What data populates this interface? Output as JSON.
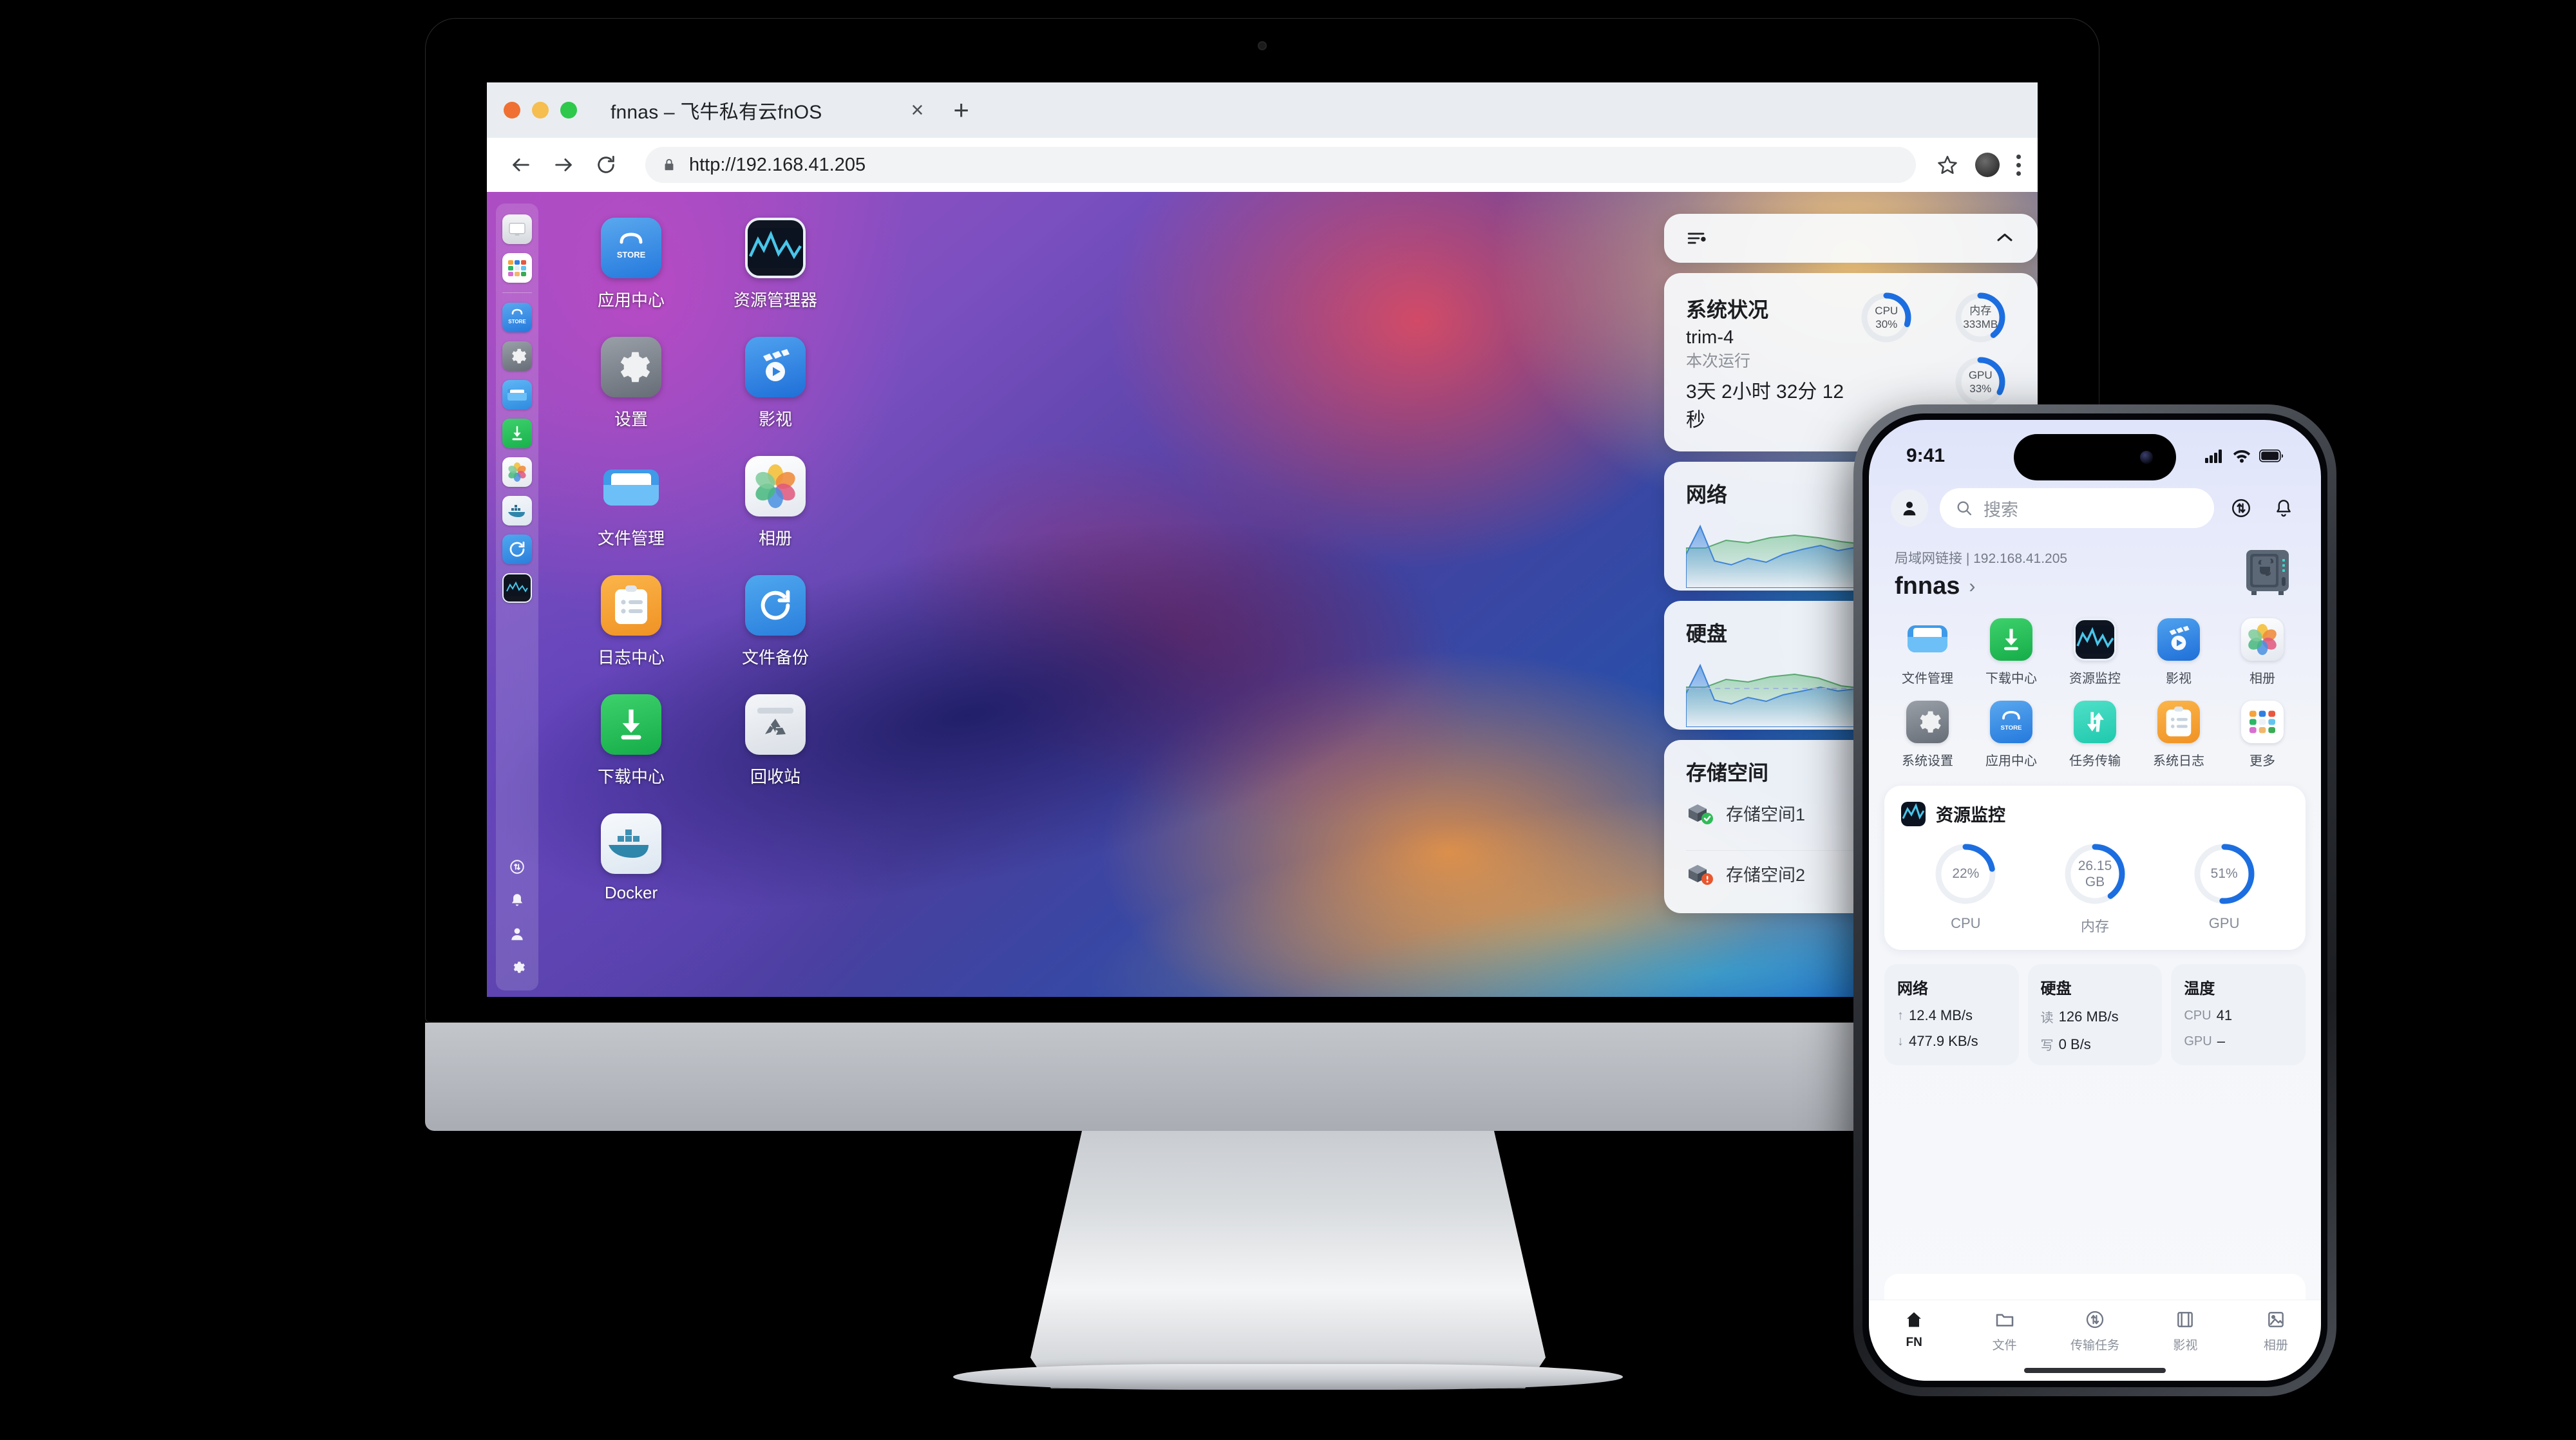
{
  "browser": {
    "tab_title": "fnnas – 飞牛私有云fnOS",
    "close_label": "×",
    "newtab_label": "+",
    "url": "http://192.168.41.205",
    "back_icon": "back-arrow-icon",
    "forward_icon": "forward-arrow-icon",
    "reload_icon": "reload-icon",
    "lock_icon": "lock-icon",
    "bookmark_icon": "star-icon",
    "profile_icon": "profile-avatar-icon",
    "menu_icon": "kebab-menu-icon"
  },
  "desktop": {
    "icons": [
      {
        "label": "应用中心",
        "icon": "app-store-icon"
      },
      {
        "label": "资源管理器",
        "icon": "resource-monitor-icon"
      },
      {
        "label": "设置",
        "icon": "settings-gear-icon"
      },
      {
        "label": "影视",
        "icon": "media-video-icon"
      },
      {
        "label": "文件管理",
        "icon": "file-manager-folder-icon"
      },
      {
        "label": "相册",
        "icon": "photos-flower-icon"
      },
      {
        "label": "日志中心",
        "icon": "log-center-clipboard-icon"
      },
      {
        "label": "文件备份",
        "icon": "file-backup-sync-icon"
      },
      {
        "label": "下载中心",
        "icon": "download-center-icon"
      },
      {
        "label": "回收站",
        "icon": "recycle-bin-icon"
      },
      {
        "label": "Docker",
        "icon": "docker-whale-icon"
      }
    ],
    "dock": [
      {
        "icon": "display-monitor-icon"
      },
      {
        "icon": "app-launcher-grid-icon"
      },
      {
        "icon": "app-store-icon"
      },
      {
        "icon": "settings-gear-icon"
      },
      {
        "icon": "file-manager-folder-icon"
      },
      {
        "icon": "download-center-icon"
      },
      {
        "icon": "photos-flower-icon"
      },
      {
        "icon": "docker-whale-icon"
      },
      {
        "icon": "file-backup-sync-icon"
      },
      {
        "icon": "resource-monitor-icon"
      }
    ],
    "dock_system": [
      {
        "icon": "transfer-tasks-icon"
      },
      {
        "icon": "notification-bell-icon"
      },
      {
        "icon": "user-account-icon"
      },
      {
        "icon": "system-settings-gear-icon"
      }
    ]
  },
  "widgets": {
    "toolbar": {
      "settings_icon": "widget-settings-icon",
      "collapse_icon": "chevron-up-icon"
    },
    "system": {
      "title": "系统状况",
      "hostname": "trim-4",
      "uptime_label": "本次运行",
      "uptime_value": "3天 2小时 32分 12秒",
      "gauges": [
        {
          "name": "CPU",
          "value": "30%",
          "percent": 30
        },
        {
          "name": "内存",
          "value": "333MB",
          "percent": 40
        },
        {
          "name": "GPU",
          "value": "33%",
          "percent": 33
        }
      ]
    },
    "network": {
      "title": "网络"
    },
    "disk": {
      "title": "硬盘"
    },
    "storage": {
      "title": "存储空间",
      "items": [
        {
          "name": "存储空间1",
          "status": "ok",
          "icon": "storage-pool-ok-icon"
        },
        {
          "name": "存储空间2",
          "status": "warning",
          "icon": "storage-pool-warning-icon"
        }
      ]
    }
  },
  "phone": {
    "status": {
      "time": "9:41",
      "signal_icon": "cellular-signal-icon",
      "wifi_icon": "wifi-icon",
      "battery_icon": "battery-icon"
    },
    "search": {
      "placeholder": "搜索",
      "search_icon": "search-icon",
      "avatar_icon": "user-avatar-icon",
      "transfer_icon": "transfer-circle-icon",
      "bell_icon": "notification-bell-icon"
    },
    "device": {
      "meta": "局域网链接 | 192.168.41.205",
      "name": "fnnas",
      "chevron": "›",
      "device_icon": "nas-device-icon"
    },
    "apps": [
      {
        "label": "文件管理",
        "icon": "file-manager-folder-icon"
      },
      {
        "label": "下载中心",
        "icon": "download-center-icon"
      },
      {
        "label": "资源监控",
        "icon": "resource-monitor-icon"
      },
      {
        "label": "影视",
        "icon": "media-video-icon"
      },
      {
        "label": "相册",
        "icon": "photos-flower-icon"
      },
      {
        "label": "系统设置",
        "icon": "settings-gear-icon"
      },
      {
        "label": "应用中心",
        "icon": "app-store-icon"
      },
      {
        "label": "任务传输",
        "icon": "task-transfer-icon"
      },
      {
        "label": "系统日志",
        "icon": "log-center-clipboard-icon"
      },
      {
        "label": "更多",
        "icon": "more-apps-grid-icon"
      }
    ],
    "monitor_card": {
      "title": "资源监控",
      "icon": "resource-monitor-icon",
      "gauges": [
        {
          "caption": "CPU",
          "value": "22%",
          "unit": "",
          "percent": 22
        },
        {
          "caption": "内存",
          "value": "26.15",
          "unit": "GB",
          "percent": 40
        },
        {
          "caption": "GPU",
          "value": "51%",
          "unit": "",
          "percent": 51
        }
      ]
    },
    "stats": [
      {
        "title": "网络",
        "rows": [
          {
            "key": "↑",
            "val": "12.4 MB/s"
          },
          {
            "key": "↓",
            "val": "477.9 KB/s"
          }
        ]
      },
      {
        "title": "硬盘",
        "rows": [
          {
            "key": "读",
            "val": "126 MB/s"
          },
          {
            "key": "写",
            "val": "0 B/s"
          }
        ]
      },
      {
        "title": "温度",
        "rows": [
          {
            "key": "CPU",
            "val": "41"
          },
          {
            "key": "GPU",
            "val": "–"
          }
        ]
      }
    ],
    "tabs": [
      {
        "label": "FN",
        "icon": "home-icon",
        "active": true
      },
      {
        "label": "文件",
        "icon": "folder-icon",
        "active": false
      },
      {
        "label": "传输任务",
        "icon": "transfer-circle-icon",
        "active": false
      },
      {
        "label": "影视",
        "icon": "film-icon",
        "active": false
      },
      {
        "label": "相册",
        "icon": "photo-icon",
        "active": false
      }
    ]
  },
  "colors": {
    "accent_blue": "#1c6ee0",
    "gauge_track": "#e6e9ed",
    "green": "#2ec84b",
    "orange": "#ef7032",
    "yellow": "#f6bd4f"
  }
}
